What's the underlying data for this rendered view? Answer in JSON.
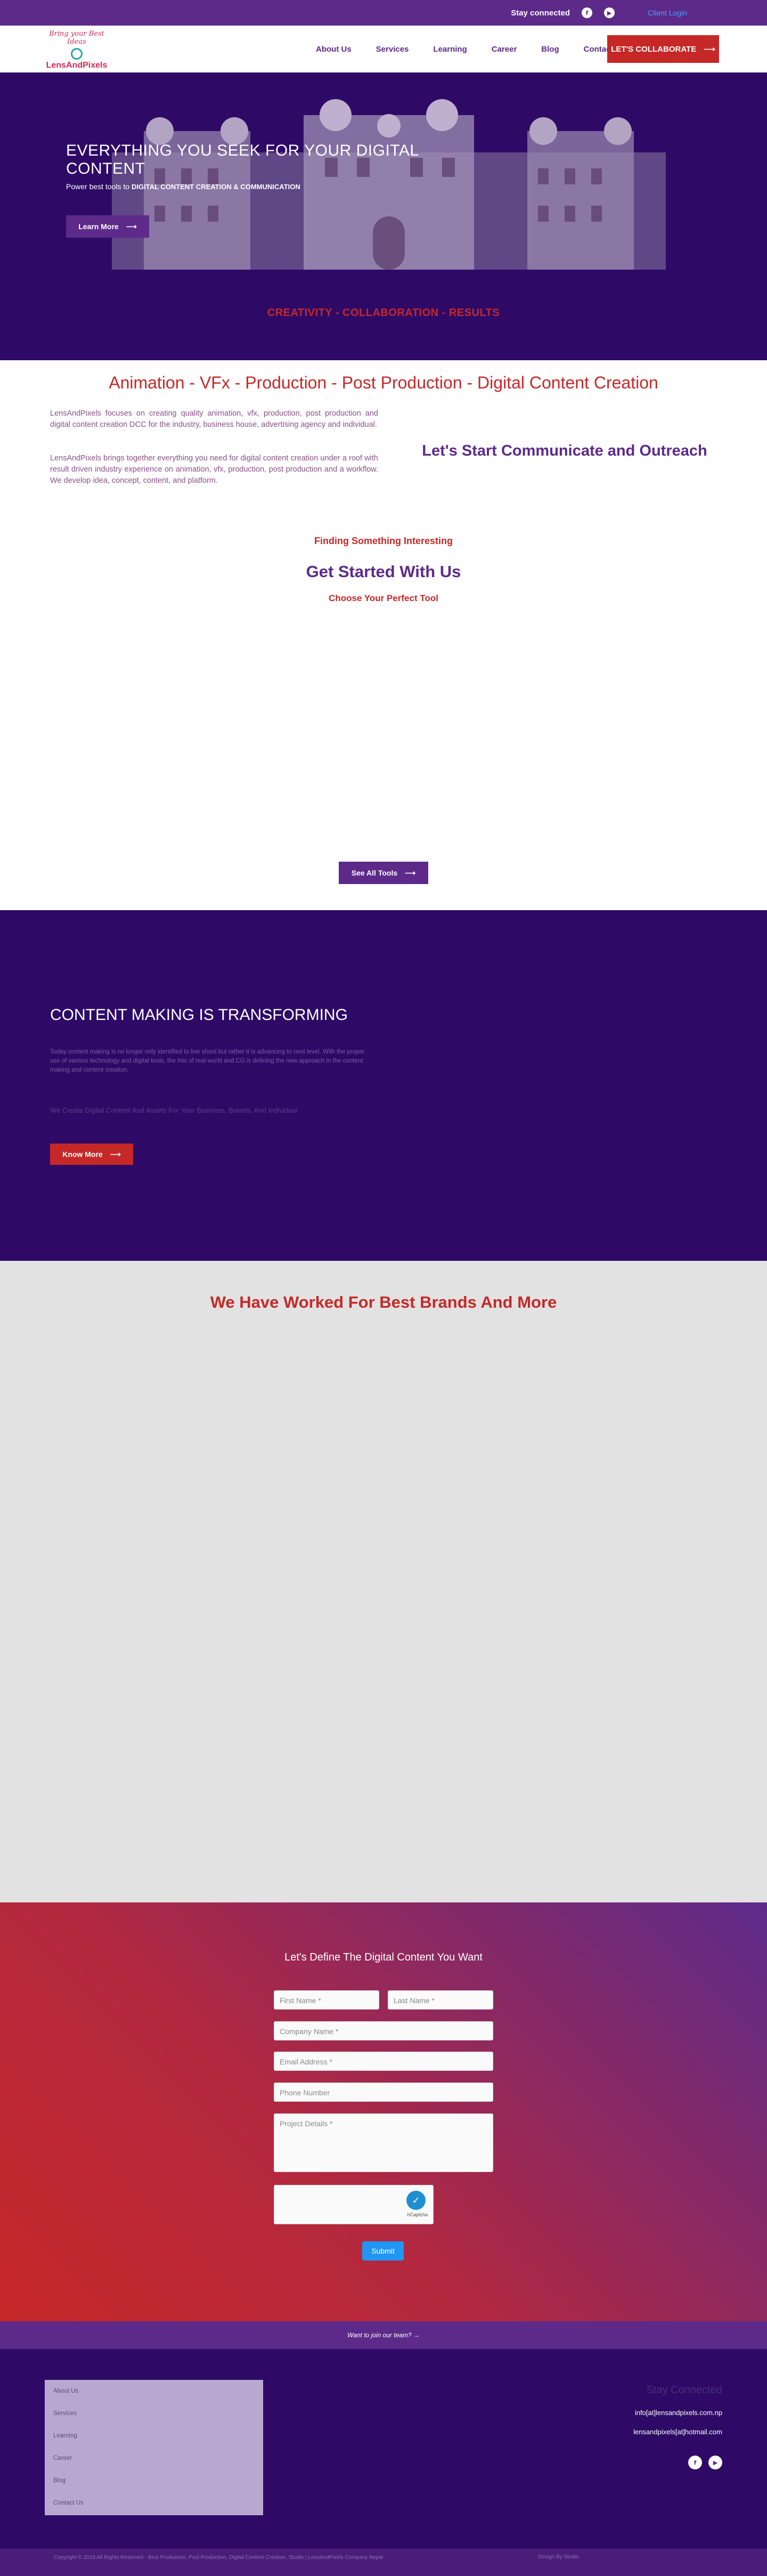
{
  "topbar": {
    "stay": "Stay connected",
    "facebook_glyph": "f",
    "youtube_glyph": "▶",
    "login": "Client Login"
  },
  "logo": {
    "tagline": "Bring your Best Ideas",
    "name": "LensAndPixels"
  },
  "nav": [
    "About Us",
    "Services",
    "Learning",
    "Career",
    "Blog",
    "Contact Us"
  ],
  "header": {
    "cta": "LET'S COLLABORATE"
  },
  "arrow": "⟶",
  "hero": {
    "title": "EVERYTHING YOU SEEK FOR YOUR DIGITAL CONTENT",
    "sub_prefix": "Power best tools to",
    "sub_bold": "DIGITAL CONTENT CREATION & COMMUNICATION",
    "button": "Learn More",
    "tagline": "CREATIVITY - COLLABORATION - RESULTS"
  },
  "intro": {
    "title": "Animation - VFx - Production - Post Production - Digital Content Creation",
    "p1": "LensAndPixels focuses on creating quality animation, vfx, production, post production and digital content creation DCC for the industry, business house, advertising agency and individual.",
    "p2": "LensAndPixels brings together everything you need for digital content creation under a roof with result driven industry experience on animation, vfx, production, post production and a workflow.  We develop idea, concept, content, and platform.",
    "right_title": "Let's Start Communicate and Outreach"
  },
  "tools": {
    "eyebrow": "Finding Something Interesting",
    "title": "Get Started With Us",
    "subtitle": "Choose Your Perfect Tool",
    "button": "See All Tools"
  },
  "transform": {
    "title": "CONTENT MAKING IS TRANSFORMING",
    "body": "Today content making is no longer only identified to live shoot but rather it is advancing to next level. With the proper use of various technology and digital tools, the mix of real world and CG is defining the new approach in the content making and content creation.",
    "tagline": "We Create Digital Content And Assets For Your Business, Brands, And Individual",
    "button": "Know More"
  },
  "brands": {
    "title": "We Have Worked For Best Brands And More"
  },
  "form": {
    "title": "Let's Define The Digital Content You Want",
    "first_name": "First Name *",
    "last_name": "Last Name *",
    "company": "Company Name *",
    "email": "Email Address *",
    "phone": "Phone Number",
    "details": "Project Details *",
    "captcha_label": "hCaptcha",
    "submit": "Submit"
  },
  "join": {
    "text": "Want to join our team? →"
  },
  "footer": {
    "menu": [
      "About Us",
      "Services",
      "Learning",
      "Career",
      "Blog",
      "Contact Us"
    ],
    "stay": "Stay Connected",
    "email1": "info[at]lensandpixels.com.np",
    "email2": "lensandpixels[at]hotmail.com",
    "copyright": "Copyright © 2019 All Rights Reserved - Best Production, Post Production, Digital Content Creation, Studio | LensAndPixels Company Nepal",
    "design": "Design By Studio"
  },
  "colors": {
    "primary": "#5d2a8a",
    "dark": "#2e0a66",
    "accent": "#c62828",
    "submit": "#2196f3"
  }
}
